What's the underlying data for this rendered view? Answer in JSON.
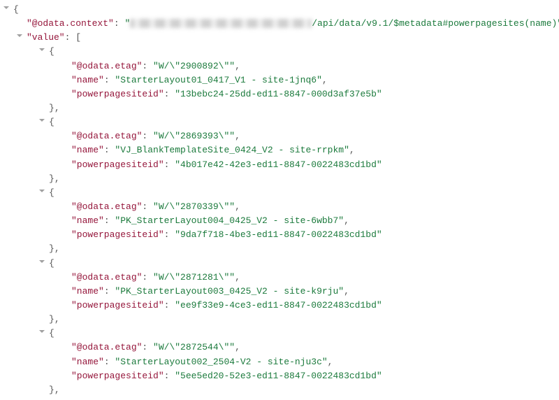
{
  "odata_context_key": "\"@odata.context\"",
  "odata_context_suffix": "/api/data/v9.1/$metadata#powerpagesites(name)\"",
  "value_key": "\"value\"",
  "etag_key": "\"@odata.etag\"",
  "name_key": "\"name\"",
  "siteid_key": "\"powerpagesiteid\"",
  "records": [
    {
      "etag": "\"W/\\\"2900892\\\"\"",
      "name": "\"StarterLayout01_0417_V1 - site-1jnq6\"",
      "id": "\"13bebc24-25dd-ed11-8847-000d3af37e5b\""
    },
    {
      "etag": "\"W/\\\"2869393\\\"\"",
      "name": "\"VJ_BlankTemplateSite_0424_V2 - site-rrpkm\"",
      "id": "\"4b017e42-42e3-ed11-8847-0022483cd1bd\""
    },
    {
      "etag": "\"W/\\\"2870339\\\"\"",
      "name": "\"PK_StarterLayout004_0425_V2 - site-6wbb7\"",
      "id": "\"9da7f718-4be3-ed11-8847-0022483cd1bd\""
    },
    {
      "etag": "\"W/\\\"2871281\\\"\"",
      "name": "\"PK_StarterLayout003_0425_V2 - site-k9rju\"",
      "id": "\"ee9f33e9-4ce3-ed11-8847-0022483cd1bd\""
    },
    {
      "etag": "\"W/\\\"2872544\\\"\"",
      "name": "\"StarterLayout002_2504-V2 - site-nju3c\"",
      "id": "\"5ee5ed20-52e3-ed11-8847-0022483cd1bd\""
    }
  ]
}
